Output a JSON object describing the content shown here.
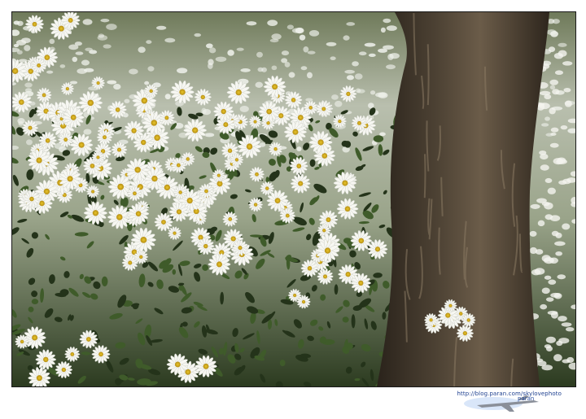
{
  "photo": {
    "subject": "white daisies beside a tree trunk",
    "colors": {
      "petal": "#f7f7f2",
      "center": "#d8b21f",
      "foliage_dark": "#24331a",
      "foliage_mid": "#3f5b2a",
      "bark": "#3d3328",
      "bark_highlight": "#7a6a55",
      "background_field": "#cfd3c6"
    }
  },
  "watermark": {
    "url": "http://blog.paran.com/skylovephoto",
    "logo": "paran-plane-logo"
  }
}
